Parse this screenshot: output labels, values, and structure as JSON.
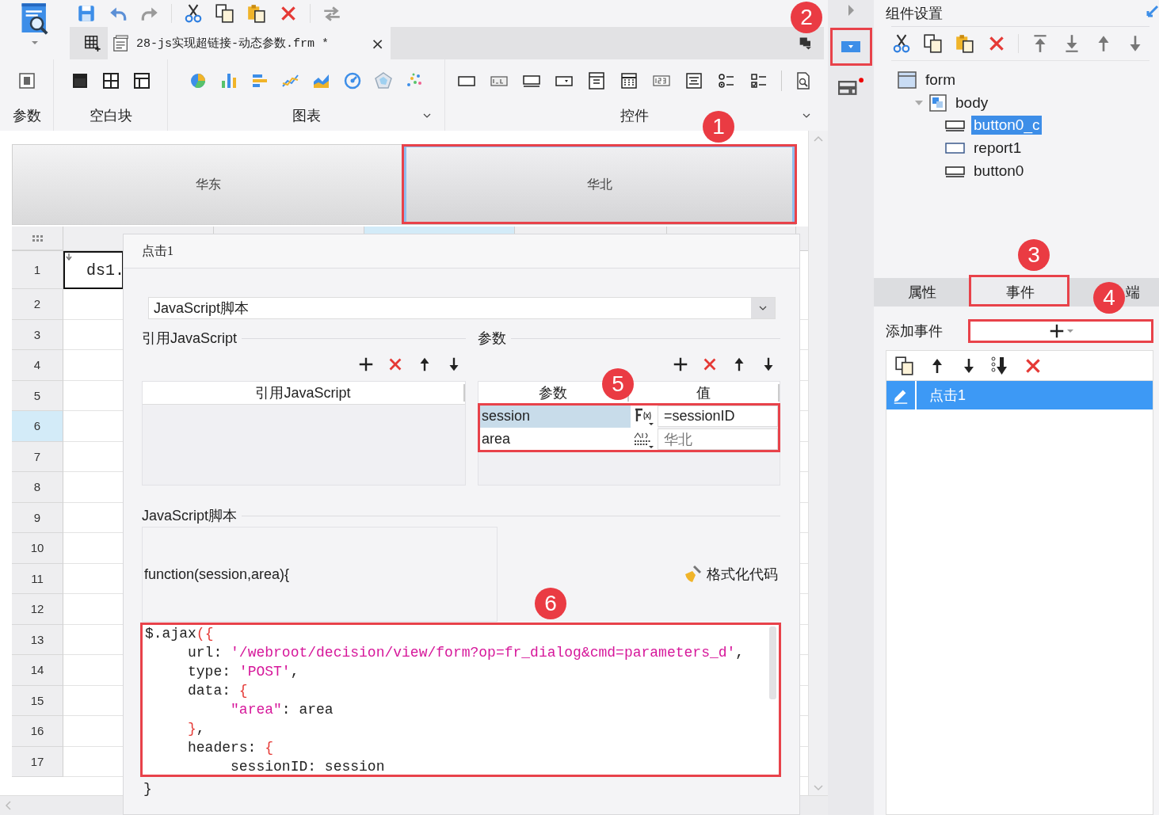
{
  "toolbar": {
    "document_tab": {
      "title": "28-js实现超链接-动态参数.frm *",
      "close": "×"
    }
  },
  "ribbon": {
    "groups": [
      {
        "label": "参数",
        "expandable": false
      },
      {
        "label": "空白块",
        "expandable": false
      },
      {
        "label": "图表",
        "expandable": true
      },
      {
        "label": "控件",
        "expandable": true
      }
    ]
  },
  "canvas": {
    "buttons": [
      {
        "label": "华东",
        "selected": false
      },
      {
        "label": "华北",
        "selected": true
      }
    ],
    "columns": [
      {
        "selected": false
      },
      {
        "selected": false
      },
      {
        "selected": true
      },
      {
        "selected": false
      },
      {
        "selected": false
      }
    ],
    "rows": [
      {
        "number": "1",
        "selected": false
      },
      {
        "number": "2",
        "selected": false
      },
      {
        "number": "3",
        "selected": false
      },
      {
        "number": "4",
        "selected": false
      },
      {
        "number": "5",
        "selected": false
      },
      {
        "number": "6",
        "selected": true
      },
      {
        "number": "7",
        "selected": false
      },
      {
        "number": "8",
        "selected": false
      },
      {
        "number": "9",
        "selected": false
      },
      {
        "number": "10",
        "selected": false
      },
      {
        "number": "11",
        "selected": false
      },
      {
        "number": "12",
        "selected": false
      },
      {
        "number": "13",
        "selected": false
      },
      {
        "number": "14",
        "selected": false
      },
      {
        "number": "15",
        "selected": false
      },
      {
        "number": "16",
        "selected": false
      },
      {
        "number": "17",
        "selected": false
      }
    ],
    "cell": "ds1."
  },
  "dialog": {
    "title": "点击1",
    "script_type": "JavaScript脚本",
    "ref_section": "引用JavaScript",
    "ref_column": "引用JavaScript",
    "params_section": "参数",
    "param_columns": [
      "参数",
      "值"
    ],
    "params": [
      {
        "name": "session",
        "kind": "formula",
        "value": "=sessionID",
        "selected": true
      },
      {
        "name": "area",
        "kind": "text",
        "value": "华北",
        "selected": false
      }
    ],
    "script_section": "JavaScript脚本",
    "signature": "function(session,area){",
    "format_button": "格式化代码",
    "code": [
      "$.ajax({",
      "     url: '/webroot/decision/view/form?op=fr_dialog&cmd=parameters_d',",
      "     type: 'POST',",
      "     data: {",
      "          \"area\": area",
      "     },",
      "     headers: {",
      "          sessionID: session"
    ],
    "closing": "}"
  },
  "panel": {
    "title": "组件设置",
    "tree": [
      {
        "label": "form",
        "kind": "form",
        "selected": false,
        "children": [
          {
            "label": "body",
            "kind": "body",
            "selected": false,
            "children": [
              {
                "label": "button0_c",
                "kind": "button",
                "selected": true
              },
              {
                "label": "report1",
                "kind": "report",
                "selected": false
              },
              {
                "label": "button0",
                "kind": "button",
                "selected": false
              }
            ]
          }
        ]
      }
    ],
    "tabs": [
      {
        "label": "属性",
        "selected": false
      },
      {
        "label": "事件",
        "selected": true
      },
      {
        "label": "端",
        "selected": false
      }
    ],
    "add_event_label": "添加事件",
    "events": [
      {
        "label": "点击1",
        "selected": true
      }
    ]
  },
  "annotations": [
    "1",
    "2",
    "3",
    "4",
    "5",
    "6"
  ]
}
